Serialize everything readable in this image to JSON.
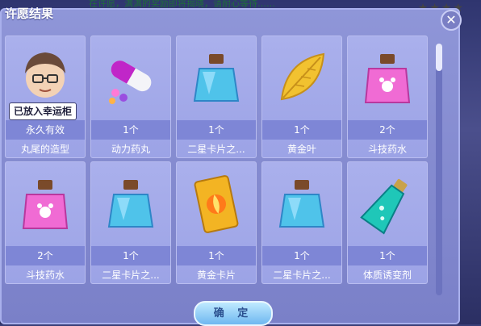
{
  "background": {
    "banner_text": "在许愿，满满的奖励即将揭晓，请耐心等待……"
  },
  "dialog": {
    "title": "许愿结果",
    "confirm_label": "确 定"
  },
  "items": [
    {
      "qty": "永久有效",
      "name": "丸尾的造型",
      "icon": "hair-style-icon",
      "badge": "已放入幸运柜"
    },
    {
      "qty": "1个",
      "name": "动力药丸",
      "icon": "pill-capsule-icon"
    },
    {
      "qty": "1个",
      "name": "二星卡片之...",
      "icon": "blue-potion-bottle-icon"
    },
    {
      "qty": "1个",
      "name": "黄金叶",
      "icon": "golden-leaf-icon"
    },
    {
      "qty": "2个",
      "name": "斗技药水",
      "icon": "pink-potion-bottle-icon"
    },
    {
      "qty": "2个",
      "name": "斗技药水",
      "icon": "pink-potion-bottle-icon"
    },
    {
      "qty": "1个",
      "name": "二星卡片之...",
      "icon": "blue-potion-bottle-icon"
    },
    {
      "qty": "1个",
      "name": "黄金卡片",
      "icon": "golden-card-icon"
    },
    {
      "qty": "1个",
      "name": "二星卡片之...",
      "icon": "blue-potion-bottle-icon"
    },
    {
      "qty": "1个",
      "name": "体质诱变剂",
      "icon": "teal-flask-icon"
    }
  ]
}
